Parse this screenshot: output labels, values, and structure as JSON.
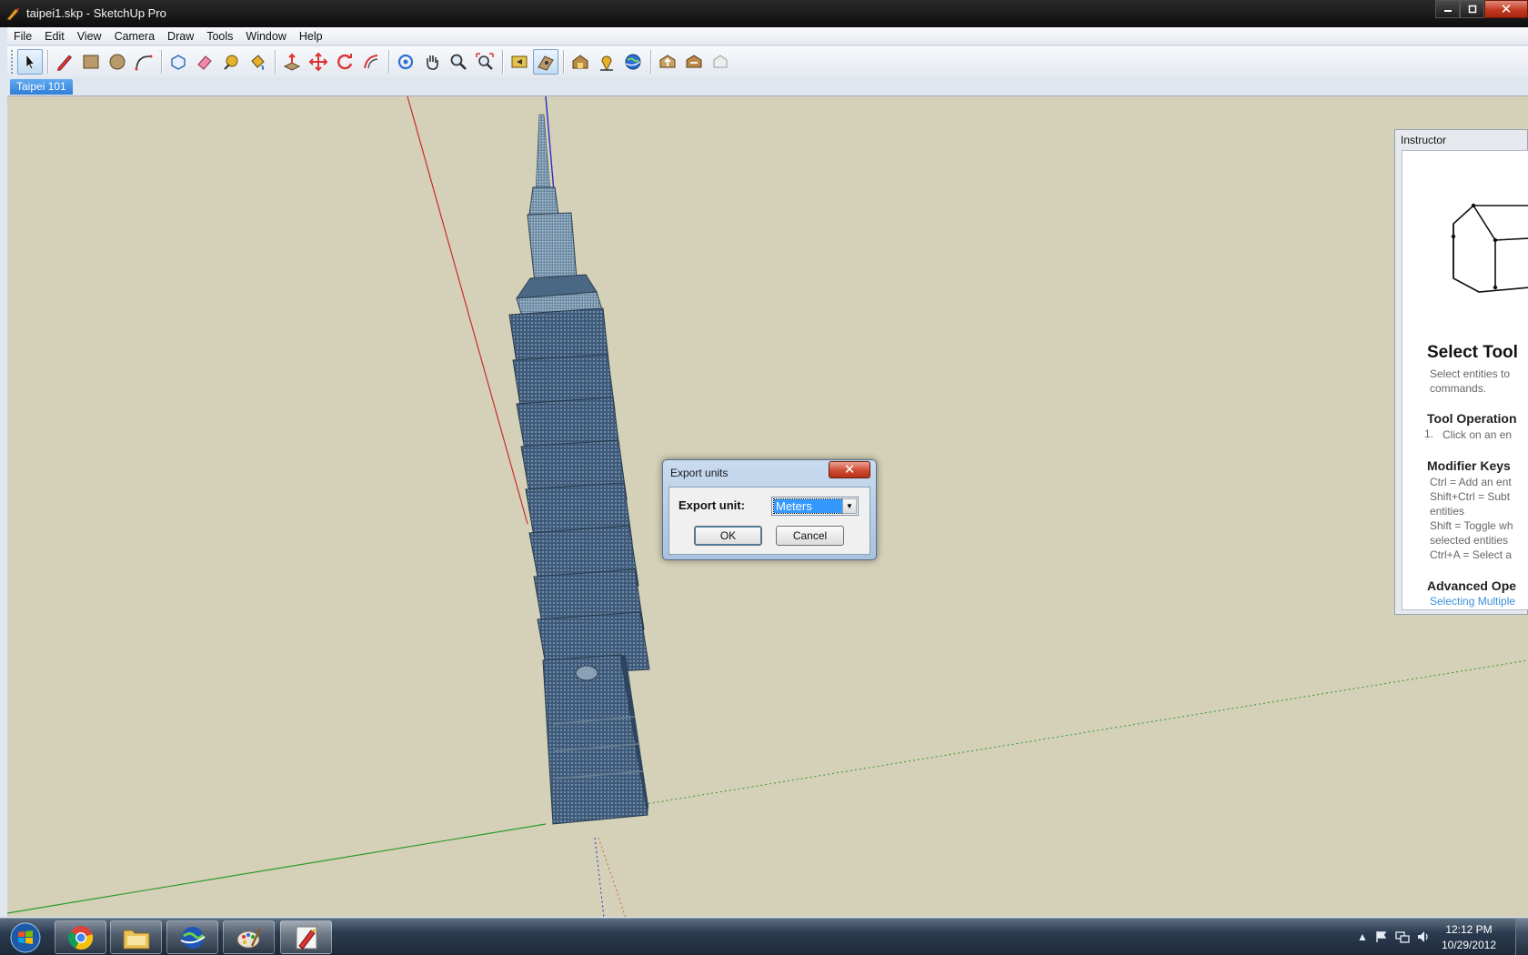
{
  "window": {
    "title": "taipei1.skp - SketchUp Pro"
  },
  "menu": [
    "File",
    "Edit",
    "View",
    "Camera",
    "Draw",
    "Tools",
    "Window",
    "Help"
  ],
  "scene_tab": "Taipei 101",
  "instructor": {
    "panel_title": "Instructor",
    "heading": "Select Tool",
    "intro": [
      "Select entities to",
      "commands."
    ],
    "section_operation": "Tool Operation",
    "operation_step_num": "1.",
    "operation_step": "Click on an en",
    "section_modifiers": "Modifier Keys",
    "modifiers": [
      "Ctrl = Add an ent",
      "Shift+Ctrl = Subt",
      "entities",
      "Shift = Toggle wh",
      "selected entities",
      "Ctrl+A = Select a"
    ],
    "section_advanced": "Advanced Ope",
    "advanced_link": "Selecting Multiple"
  },
  "dialog": {
    "title": "Export units",
    "label": "Export unit:",
    "selected_value": "Meters",
    "ok_label": "OK",
    "cancel_label": "Cancel"
  },
  "taskbar": {
    "time": "12:12 PM",
    "date": "10/29/2012"
  },
  "colors": {
    "viewport_bg": "#d4d1b8",
    "axis_red": "#cc2a2a",
    "axis_green": "#2e9a2e",
    "axis_blue": "#2a2acc",
    "tower": "#4a6784"
  }
}
